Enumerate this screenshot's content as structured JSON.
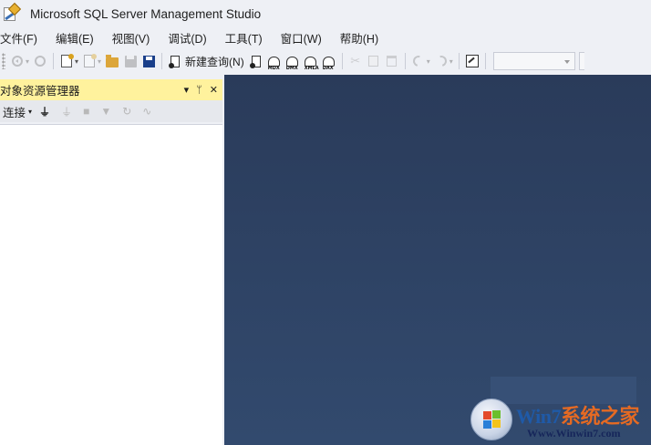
{
  "titlebar": {
    "icon": "ssms-app-icon",
    "title": "Microsoft SQL Server Management Studio"
  },
  "menu": {
    "items": [
      "文件(F)",
      "编辑(E)",
      "视图(V)",
      "调试(D)",
      "工具(T)",
      "窗口(W)",
      "帮助(H)"
    ]
  },
  "toolbar": {
    "new_query_label": "新建查询(N)",
    "cube_labels": [
      "MDX",
      "DMX",
      "XMLA",
      "DAX"
    ]
  },
  "object_explorer": {
    "title": "对象资源管理器",
    "pin_glyph": "▾",
    "autohide_glyph": "ᛘ",
    "close_glyph": "✕",
    "connect_label": "连接",
    "connect_caret": "▾"
  },
  "watermark": {
    "brand_en": "Win7",
    "brand_cn": "系统之家",
    "url": "Www.Winwin7.com"
  },
  "colors": {
    "panel_header": "#fff29d",
    "document_area": "#2d4064",
    "chrome": "#eef0f5"
  }
}
